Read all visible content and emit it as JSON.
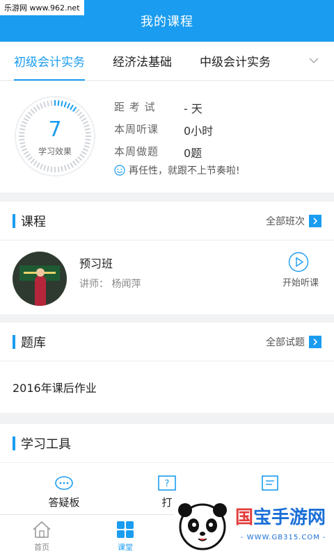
{
  "watermark_top": "乐游网 www.962.net",
  "header": {
    "title": "我的课程"
  },
  "tabs": [
    {
      "label": "初级会计实务"
    },
    {
      "label": "经济法基础"
    },
    {
      "label": "中级会计实务"
    }
  ],
  "stats": {
    "gauge_value": "7",
    "gauge_label": "学习效果",
    "rows": [
      {
        "key": "距 考 试",
        "value": "- 天"
      },
      {
        "key": "本周听课",
        "value": "0小时"
      },
      {
        "key": "本周做题",
        "value": "0题"
      }
    ],
    "tip": "再任性，就跟不上节奏啦!"
  },
  "courses": {
    "title": "课程",
    "more": "全部班次",
    "item": {
      "name": "预习班",
      "teacher": "讲师：  杨闻萍",
      "action": "开始听课"
    }
  },
  "question_bank": {
    "title": "题库",
    "more": "全部试题",
    "item": "2016年课后作业"
  },
  "tools": {
    "title": "学习工具",
    "items": [
      {
        "label": "答疑板"
      },
      {
        "label": "打"
      }
    ]
  },
  "bottom_nav": [
    {
      "label": "首页"
    },
    {
      "label": "课堂"
    }
  ],
  "watermark_brand": {
    "part1": "国",
    "part2": "宝手游网",
    "url": "- WWW.GB315.COM -"
  },
  "colors": {
    "accent": "#1a9cf0",
    "background": "#f1f2f4"
  }
}
